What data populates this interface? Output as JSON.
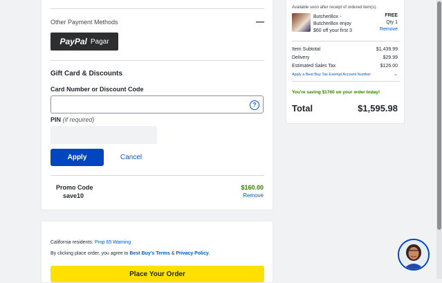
{
  "payment": {
    "other_methods_label": "Other Payment Methods",
    "collapse_symbol": "—",
    "paypal_logo": "PayPal",
    "paypal_action": "Pagar"
  },
  "gift_card": {
    "heading": "Gift Card & Discounts",
    "card_label": "Card Number or Discount Code",
    "card_value": "",
    "help_glyph": "?",
    "pin_label": "PIN",
    "pin_hint": "(if required)",
    "pin_value": "",
    "apply_label": "Apply",
    "cancel_label": "Cancel"
  },
  "promo": {
    "label": "Promo Code",
    "code": "save10",
    "amount": "$160.00",
    "remove_label": "Remove"
  },
  "legal": {
    "ca_residents": "California residents:",
    "prop65_link": "Prop 65 Warning",
    "agree_prefix": "By clicking place order, you agree to ",
    "terms_link": "Best Buy's Terms",
    "and": " & ",
    "privacy_link": "Privacy Policy",
    "period": ".",
    "place_order_label": "Place Your Order"
  },
  "summary": {
    "availability_note": "Available soon after receipt of ordered item(s).",
    "item": {
      "title_line1": "ButcherBox -",
      "title_line2": "ButcherBox enjoy",
      "title_line3": "$60 off your first 3",
      "price": "FREE",
      "qty": "Qty 1",
      "remove_label": "Remove"
    },
    "item_subtotal_label": "Item Subtotal",
    "item_subtotal_value": "$1,439.99",
    "delivery_label": "Delivery",
    "delivery_value": "$29.99",
    "tax_label": "Estimated Sales Tax",
    "tax_value": "$126.00",
    "tax_exempt_link": "Apply a Best Buy Tax Exempt Account Number",
    "savings_msg": "You're saving $1760 on your order today!",
    "total_label": "Total",
    "total_value": "$1,595.98"
  },
  "colors": {
    "primary_blue": "#0046be",
    "link_blue": "#0457c8",
    "savings_green": "#318000",
    "place_order_yellow": "#ffe000"
  }
}
